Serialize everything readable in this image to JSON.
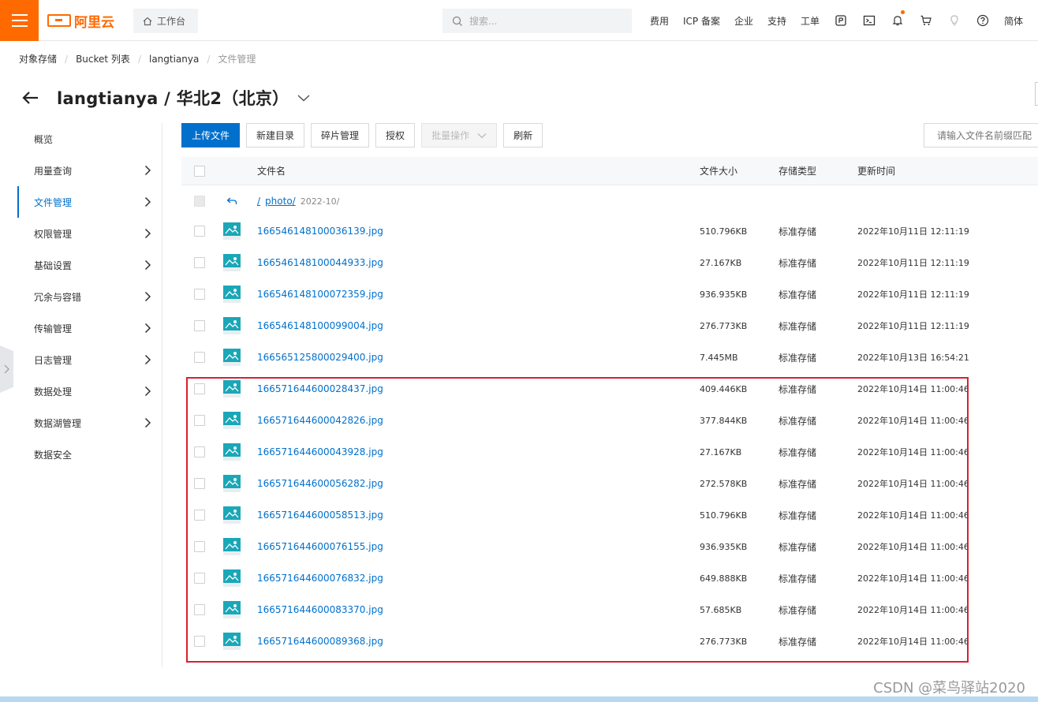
{
  "header": {
    "logo_text": "阿里云",
    "workbench_label": "工作台",
    "search_placeholder": "搜索...",
    "nav": [
      "费用",
      "ICP 备案",
      "企业",
      "支持",
      "工单"
    ],
    "lang": "简体",
    "brand_color": "#ff6a00"
  },
  "breadcrumb": {
    "items": [
      "对象存储",
      "Bucket 列表",
      "langtianya"
    ],
    "current": "文件管理"
  },
  "page": {
    "title": "langtianya / 华北2（北京）"
  },
  "sidebar": {
    "items": [
      {
        "label": "概览"
      },
      {
        "label": "用量查询"
      },
      {
        "label": "文件管理"
      },
      {
        "label": "权限管理"
      },
      {
        "label": "基础设置"
      },
      {
        "label": "冗余与容错"
      },
      {
        "label": "传输管理"
      },
      {
        "label": "日志管理"
      },
      {
        "label": "数据处理"
      },
      {
        "label": "数据湖管理"
      },
      {
        "label": "数据安全"
      }
    ]
  },
  "toolbar": {
    "upload": "上传文件",
    "new_dir": "新建目录",
    "fragments": "碎片管理",
    "authorize": "授权",
    "batch": "批量操作",
    "refresh": "刷新",
    "filter_placeholder": "请输入文件名前缀匹配"
  },
  "table": {
    "headers": {
      "name": "文件名",
      "size": "文件大小",
      "type": "存储类型",
      "time": "更新时间"
    },
    "parent_row": {
      "root": "/",
      "dir": "photo/",
      "sub": "2022-10/"
    },
    "rows": [
      {
        "name": "166546148100036139.jpg",
        "size": "510.796KB",
        "type": "标准存储",
        "time": "2022年10月11日 12:11:19"
      },
      {
        "name": "166546148100044933.jpg",
        "size": "27.167KB",
        "type": "标准存储",
        "time": "2022年10月11日 12:11:19"
      },
      {
        "name": "166546148100072359.jpg",
        "size": "936.935KB",
        "type": "标准存储",
        "time": "2022年10月11日 12:11:19"
      },
      {
        "name": "166546148100099004.jpg",
        "size": "276.773KB",
        "type": "标准存储",
        "time": "2022年10月11日 12:11:19"
      },
      {
        "name": "166565125800029400.jpg",
        "size": "7.445MB",
        "type": "标准存储",
        "time": "2022年10月13日 16:54:21"
      },
      {
        "name": "166571644600028437.jpg",
        "size": "409.446KB",
        "type": "标准存储",
        "time": "2022年10月14日 11:00:46"
      },
      {
        "name": "166571644600042826.jpg",
        "size": "377.844KB",
        "type": "标准存储",
        "time": "2022年10月14日 11:00:46"
      },
      {
        "name": "166571644600043928.jpg",
        "size": "27.167KB",
        "type": "标准存储",
        "time": "2022年10月14日 11:00:46"
      },
      {
        "name": "166571644600056282.jpg",
        "size": "272.578KB",
        "type": "标准存储",
        "time": "2022年10月14日 11:00:46"
      },
      {
        "name": "166571644600058513.jpg",
        "size": "510.796KB",
        "type": "标准存储",
        "time": "2022年10月14日 11:00:46"
      },
      {
        "name": "166571644600076155.jpg",
        "size": "936.935KB",
        "type": "标准存储",
        "time": "2022年10月14日 11:00:46"
      },
      {
        "name": "166571644600076832.jpg",
        "size": "649.888KB",
        "type": "标准存储",
        "time": "2022年10月14日 11:00:46"
      },
      {
        "name": "166571644600083370.jpg",
        "size": "57.685KB",
        "type": "标准存储",
        "time": "2022年10月14日 11:00:46"
      },
      {
        "name": "166571644600089368.jpg",
        "size": "276.773KB",
        "type": "标准存储",
        "time": "2022年10月14日 11:00:46"
      }
    ]
  },
  "watermark": "CSDN @菜鸟驿站2020"
}
